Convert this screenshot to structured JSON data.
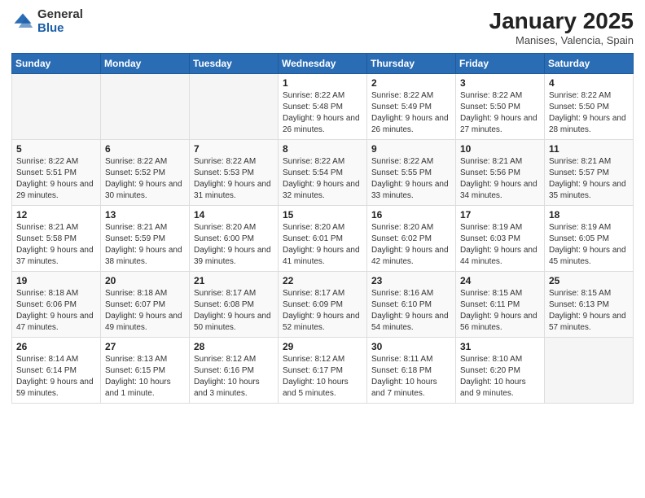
{
  "logo": {
    "general": "General",
    "blue": "Blue"
  },
  "title": "January 2025",
  "location": "Manises, Valencia, Spain",
  "weekdays": [
    "Sunday",
    "Monday",
    "Tuesday",
    "Wednesday",
    "Thursday",
    "Friday",
    "Saturday"
  ],
  "weeks": [
    [
      {
        "day": "",
        "sunrise": "",
        "sunset": "",
        "daylight": ""
      },
      {
        "day": "",
        "sunrise": "",
        "sunset": "",
        "daylight": ""
      },
      {
        "day": "",
        "sunrise": "",
        "sunset": "",
        "daylight": ""
      },
      {
        "day": "1",
        "sunrise": "Sunrise: 8:22 AM",
        "sunset": "Sunset: 5:48 PM",
        "daylight": "Daylight: 9 hours and 26 minutes."
      },
      {
        "day": "2",
        "sunrise": "Sunrise: 8:22 AM",
        "sunset": "Sunset: 5:49 PM",
        "daylight": "Daylight: 9 hours and 26 minutes."
      },
      {
        "day": "3",
        "sunrise": "Sunrise: 8:22 AM",
        "sunset": "Sunset: 5:50 PM",
        "daylight": "Daylight: 9 hours and 27 minutes."
      },
      {
        "day": "4",
        "sunrise": "Sunrise: 8:22 AM",
        "sunset": "Sunset: 5:50 PM",
        "daylight": "Daylight: 9 hours and 28 minutes."
      }
    ],
    [
      {
        "day": "5",
        "sunrise": "Sunrise: 8:22 AM",
        "sunset": "Sunset: 5:51 PM",
        "daylight": "Daylight: 9 hours and 29 minutes."
      },
      {
        "day": "6",
        "sunrise": "Sunrise: 8:22 AM",
        "sunset": "Sunset: 5:52 PM",
        "daylight": "Daylight: 9 hours and 30 minutes."
      },
      {
        "day": "7",
        "sunrise": "Sunrise: 8:22 AM",
        "sunset": "Sunset: 5:53 PM",
        "daylight": "Daylight: 9 hours and 31 minutes."
      },
      {
        "day": "8",
        "sunrise": "Sunrise: 8:22 AM",
        "sunset": "Sunset: 5:54 PM",
        "daylight": "Daylight: 9 hours and 32 minutes."
      },
      {
        "day": "9",
        "sunrise": "Sunrise: 8:22 AM",
        "sunset": "Sunset: 5:55 PM",
        "daylight": "Daylight: 9 hours and 33 minutes."
      },
      {
        "day": "10",
        "sunrise": "Sunrise: 8:21 AM",
        "sunset": "Sunset: 5:56 PM",
        "daylight": "Daylight: 9 hours and 34 minutes."
      },
      {
        "day": "11",
        "sunrise": "Sunrise: 8:21 AM",
        "sunset": "Sunset: 5:57 PM",
        "daylight": "Daylight: 9 hours and 35 minutes."
      }
    ],
    [
      {
        "day": "12",
        "sunrise": "Sunrise: 8:21 AM",
        "sunset": "Sunset: 5:58 PM",
        "daylight": "Daylight: 9 hours and 37 minutes."
      },
      {
        "day": "13",
        "sunrise": "Sunrise: 8:21 AM",
        "sunset": "Sunset: 5:59 PM",
        "daylight": "Daylight: 9 hours and 38 minutes."
      },
      {
        "day": "14",
        "sunrise": "Sunrise: 8:20 AM",
        "sunset": "Sunset: 6:00 PM",
        "daylight": "Daylight: 9 hours and 39 minutes."
      },
      {
        "day": "15",
        "sunrise": "Sunrise: 8:20 AM",
        "sunset": "Sunset: 6:01 PM",
        "daylight": "Daylight: 9 hours and 41 minutes."
      },
      {
        "day": "16",
        "sunrise": "Sunrise: 8:20 AM",
        "sunset": "Sunset: 6:02 PM",
        "daylight": "Daylight: 9 hours and 42 minutes."
      },
      {
        "day": "17",
        "sunrise": "Sunrise: 8:19 AM",
        "sunset": "Sunset: 6:03 PM",
        "daylight": "Daylight: 9 hours and 44 minutes."
      },
      {
        "day": "18",
        "sunrise": "Sunrise: 8:19 AM",
        "sunset": "Sunset: 6:05 PM",
        "daylight": "Daylight: 9 hours and 45 minutes."
      }
    ],
    [
      {
        "day": "19",
        "sunrise": "Sunrise: 8:18 AM",
        "sunset": "Sunset: 6:06 PM",
        "daylight": "Daylight: 9 hours and 47 minutes."
      },
      {
        "day": "20",
        "sunrise": "Sunrise: 8:18 AM",
        "sunset": "Sunset: 6:07 PM",
        "daylight": "Daylight: 9 hours and 49 minutes."
      },
      {
        "day": "21",
        "sunrise": "Sunrise: 8:17 AM",
        "sunset": "Sunset: 6:08 PM",
        "daylight": "Daylight: 9 hours and 50 minutes."
      },
      {
        "day": "22",
        "sunrise": "Sunrise: 8:17 AM",
        "sunset": "Sunset: 6:09 PM",
        "daylight": "Daylight: 9 hours and 52 minutes."
      },
      {
        "day": "23",
        "sunrise": "Sunrise: 8:16 AM",
        "sunset": "Sunset: 6:10 PM",
        "daylight": "Daylight: 9 hours and 54 minutes."
      },
      {
        "day": "24",
        "sunrise": "Sunrise: 8:15 AM",
        "sunset": "Sunset: 6:11 PM",
        "daylight": "Daylight: 9 hours and 56 minutes."
      },
      {
        "day": "25",
        "sunrise": "Sunrise: 8:15 AM",
        "sunset": "Sunset: 6:13 PM",
        "daylight": "Daylight: 9 hours and 57 minutes."
      }
    ],
    [
      {
        "day": "26",
        "sunrise": "Sunrise: 8:14 AM",
        "sunset": "Sunset: 6:14 PM",
        "daylight": "Daylight: 9 hours and 59 minutes."
      },
      {
        "day": "27",
        "sunrise": "Sunrise: 8:13 AM",
        "sunset": "Sunset: 6:15 PM",
        "daylight": "Daylight: 10 hours and 1 minute."
      },
      {
        "day": "28",
        "sunrise": "Sunrise: 8:12 AM",
        "sunset": "Sunset: 6:16 PM",
        "daylight": "Daylight: 10 hours and 3 minutes."
      },
      {
        "day": "29",
        "sunrise": "Sunrise: 8:12 AM",
        "sunset": "Sunset: 6:17 PM",
        "daylight": "Daylight: 10 hours and 5 minutes."
      },
      {
        "day": "30",
        "sunrise": "Sunrise: 8:11 AM",
        "sunset": "Sunset: 6:18 PM",
        "daylight": "Daylight: 10 hours and 7 minutes."
      },
      {
        "day": "31",
        "sunrise": "Sunrise: 8:10 AM",
        "sunset": "Sunset: 6:20 PM",
        "daylight": "Daylight: 10 hours and 9 minutes."
      },
      {
        "day": "",
        "sunrise": "",
        "sunset": "",
        "daylight": ""
      }
    ]
  ]
}
